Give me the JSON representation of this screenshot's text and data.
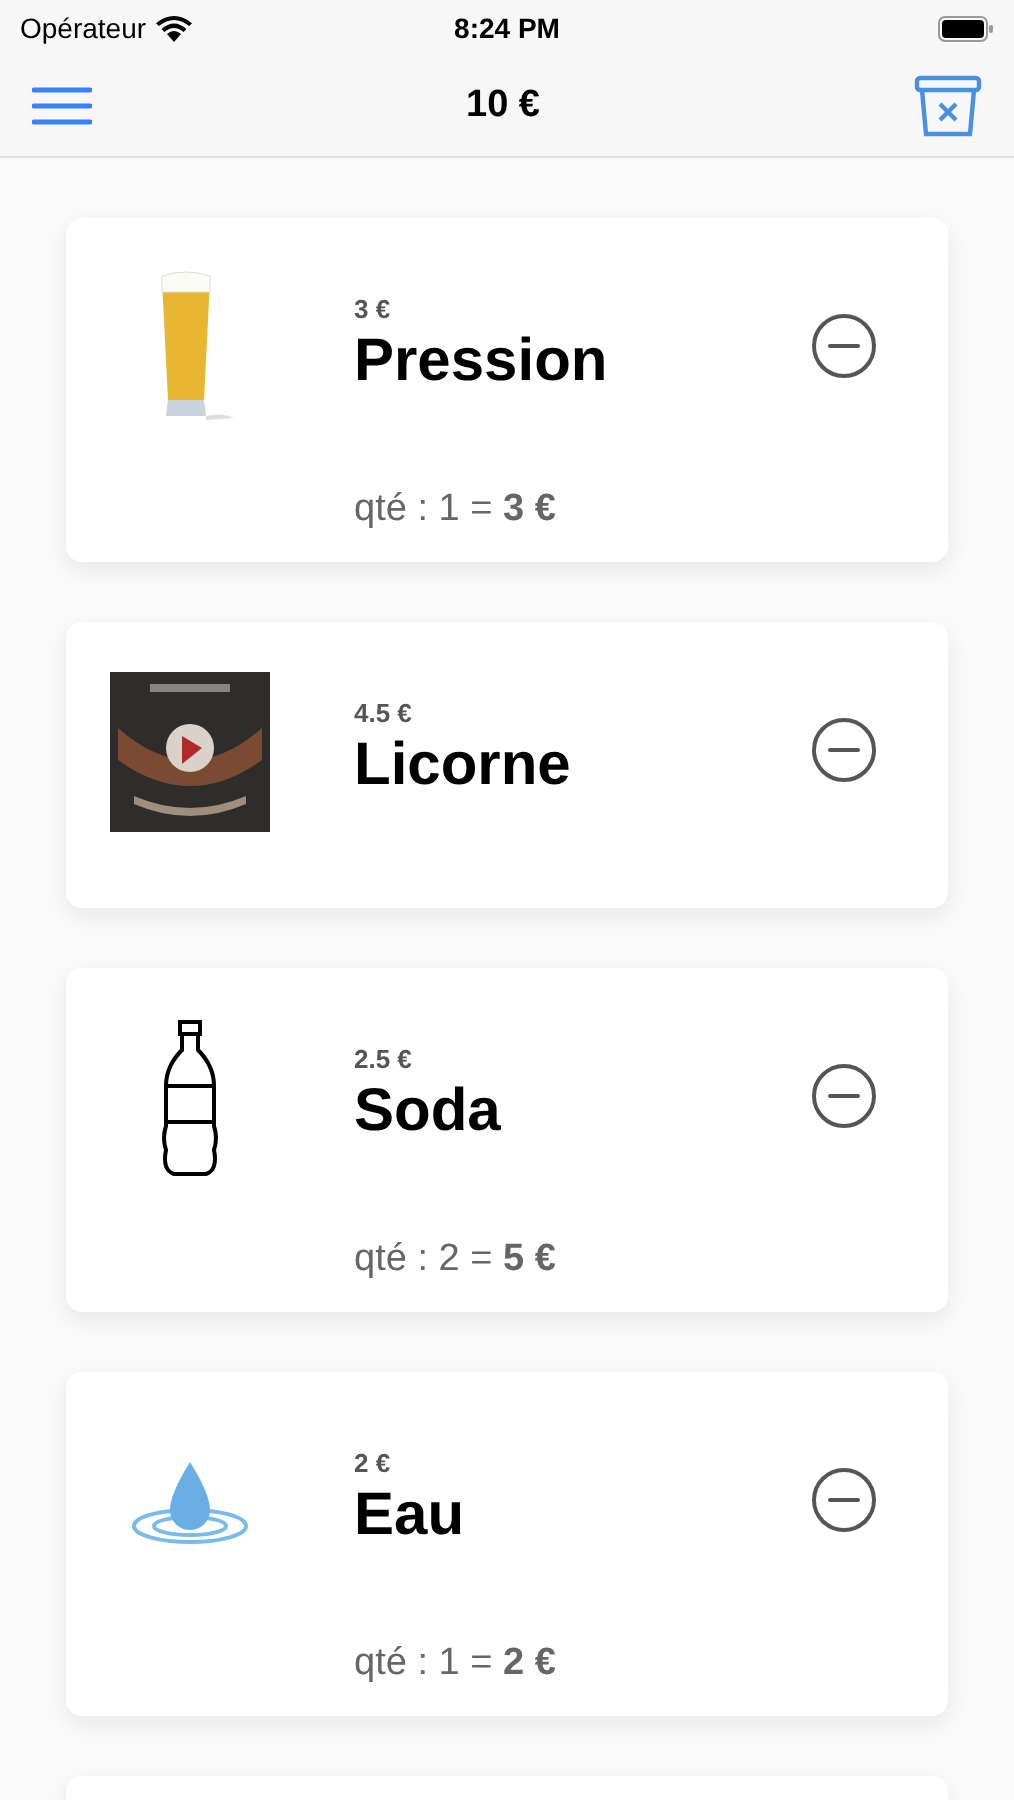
{
  "status_bar": {
    "carrier": "Opérateur",
    "time": "8:24 PM"
  },
  "nav_bar": {
    "title": "10 €"
  },
  "items": [
    {
      "kind": "beer",
      "price": "3 €",
      "name": "Pression",
      "quantity": "qté : 1 = **3 €**"
    },
    {
      "kind": "picture",
      "price": "4.5 €",
      "name": "Licorne"
    },
    {
      "kind": "bottle",
      "price": "2.5 €",
      "name": "Soda",
      "quantity": "qté : 2 = **5 €**"
    },
    {
      "kind": "water",
      "price": "2 €",
      "name": "Eau",
      "quantity": "qté : 1 = **2 €**"
    }
  ]
}
